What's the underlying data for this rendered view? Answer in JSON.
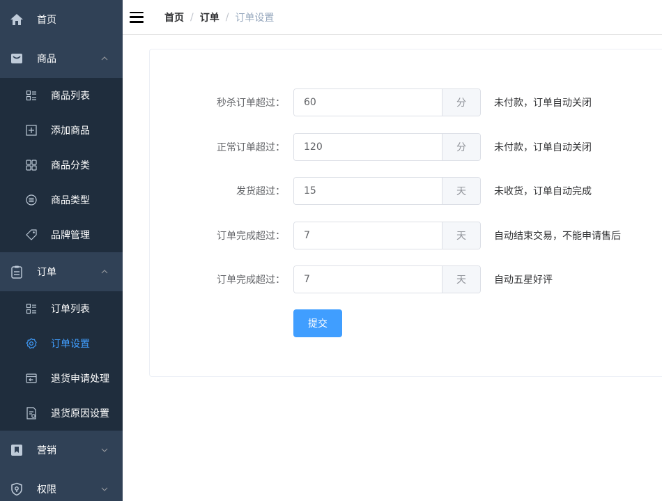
{
  "sidebar": {
    "home": {
      "label": "首页",
      "icon": "home-icon"
    },
    "goods": {
      "label": "商品",
      "icon": "goods-icon",
      "expanded": true,
      "items": [
        {
          "label": "商品列表",
          "icon": "list-icon"
        },
        {
          "label": "添加商品",
          "icon": "add-icon"
        },
        {
          "label": "商品分类",
          "icon": "grid-icon"
        },
        {
          "label": "商品类型",
          "icon": "type-icon"
        },
        {
          "label": "品牌管理",
          "icon": "tag-icon"
        }
      ]
    },
    "order": {
      "label": "订单",
      "icon": "clipboard-icon",
      "expanded": true,
      "items": [
        {
          "label": "订单列表",
          "icon": "list-icon"
        },
        {
          "label": "订单设置",
          "icon": "gear-icon",
          "active": true
        },
        {
          "label": "退货申请处理",
          "icon": "return-icon"
        },
        {
          "label": "退货原因设置",
          "icon": "document-icon"
        }
      ]
    },
    "marketing": {
      "label": "营销",
      "icon": "bookmark-icon",
      "expanded": false
    },
    "permission": {
      "label": "权限",
      "icon": "shield-icon",
      "expanded": false
    }
  },
  "header": {
    "breadcrumb": [
      "首页",
      "订单",
      "订单设置"
    ],
    "separator": "/"
  },
  "form": {
    "rows": [
      {
        "label": "秒杀订单超过：",
        "value": "60",
        "unit": "分",
        "hint": "未付款，订单自动关闭"
      },
      {
        "label": "正常订单超过：",
        "value": "120",
        "unit": "分",
        "hint": "未付款，订单自动关闭"
      },
      {
        "label": "发货超过：",
        "value": "15",
        "unit": "天",
        "hint": "未收货，订单自动完成"
      },
      {
        "label": "订单完成超过：",
        "value": "7",
        "unit": "天",
        "hint": "自动结束交易，不能申请售后"
      },
      {
        "label": "订单完成超过：",
        "value": "7",
        "unit": "天",
        "hint": "自动五星好评"
      }
    ],
    "submit_label": "提交"
  },
  "colors": {
    "sidebar_bg": "#304156",
    "submenu_bg": "#1f2d3d",
    "active": "#409eff",
    "primary": "#409eff"
  }
}
